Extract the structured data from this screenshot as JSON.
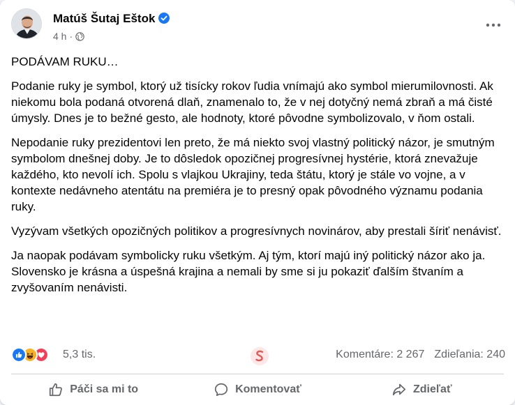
{
  "post": {
    "author": "Matúš Šutaj Eštok",
    "time": "4 h",
    "paragraphs": [
      "PODÁVAM RUKU…",
      "Podanie ruky je symbol, ktorý už tisícky rokov ľudia vnímajú ako symbol mierumilovnosti. Ak niekomu bola podaná otvorená dlaň, znamenalo to, že v nej dotyčný nemá zbraň a má čisté úmysly. Dnes je to bežné gesto, ale hodnoty, ktoré pôvodne symbolizovalo, v ňom ostali.",
      "Nepodanie ruky prezidentovi len preto, že má niekto svoj vlastný politický názor, je smutným symbolom dnešnej doby. Je to dôsledok opozičnej progresívnej hystérie, ktorá znevažuje každého, kto nevolí ich. Spolu s vlajkou Ukrajiny, teda štátu, ktorý je stále vo vojne, a v kontexte nedávneho atentátu na premiéra je to presný opak pôvodného významu podania ruky.",
      "Vyzývam všetkých opozičných politikov a progresívnych novinárov, aby prestali šíriť nenávisť.",
      "Ja naopak podávam symbolicky ruku všetkým. Aj tým, ktorí majú iný politický názor ako ja. Slovensko je krásna a úspešná krajina a nemali by sme si ju pokaziť ďalším štvaním a zvyšovaním nenávisti."
    ]
  },
  "reactions": {
    "icons": [
      "like-reaction-icon",
      "haha-reaction-icon",
      "love-reaction-icon"
    ],
    "count": "5,3 tis.",
    "comments": "Komentáre: 2 267",
    "shares": "Zdieľania: 240"
  },
  "actions": {
    "like": "Páči sa mi to",
    "comment": "Komentovať",
    "share": "Zdieľať"
  },
  "colors": {
    "like_blue": "#1877f2",
    "love_red": "#f33e58",
    "haha_yellow": "#f7b125",
    "text_secondary": "#65676b",
    "verified_blue": "#1877f2"
  }
}
